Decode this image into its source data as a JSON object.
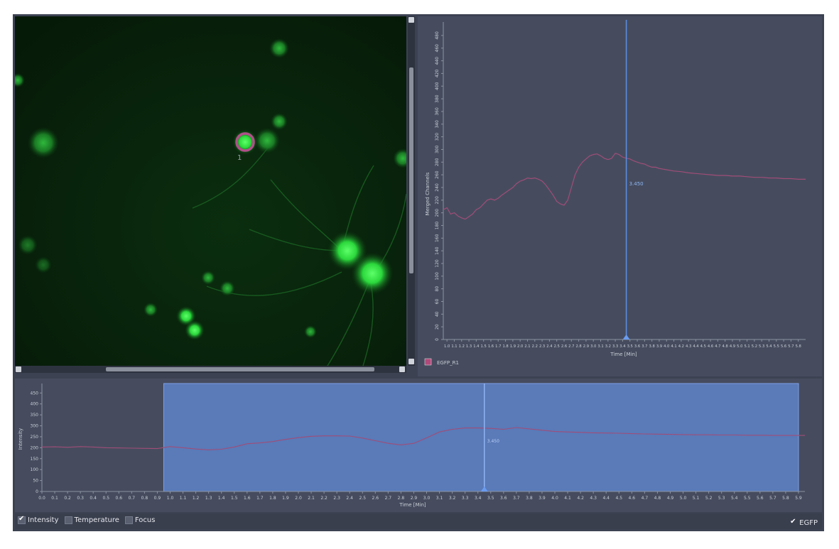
{
  "viewer": {
    "roi_label": "1"
  },
  "upper_chart": {
    "ylabel": "Merged Channels",
    "xlabel": "Time [Min]",
    "cursor_label": "3.450",
    "legend_label": "EGFP_R1"
  },
  "lower_chart": {
    "ylabel": "Intensity",
    "xlabel": "Time [Min]",
    "cursor_label": "3.450"
  },
  "toolbar": {
    "intensity_label": "Intensity",
    "temperature_label": "Temperature",
    "focus_label": "Focus",
    "egfp_label": "EGFP",
    "intensity_checked": true,
    "temperature_checked": false,
    "focus_checked": false,
    "egfp_checked": true
  },
  "colors": {
    "series": "#a04d78",
    "cursor": "#5b8ee6",
    "selection": "#5a7ab8",
    "legend_swatch": "#b04a7a"
  },
  "chart_data": [
    {
      "type": "line",
      "name": "upper",
      "ylabel": "Merged Channels",
      "xlabel": "Time [Min]",
      "ylim": [
        0,
        490
      ],
      "yticks": [
        0,
        20,
        40,
        60,
        80,
        100,
        120,
        140,
        160,
        180,
        200,
        220,
        240,
        260,
        280,
        300,
        320,
        340,
        360,
        380,
        400,
        420,
        440,
        460,
        480
      ],
      "xlim": [
        0.95,
        5.9
      ],
      "xticks": [
        "1.0",
        "1.1",
        "1.2",
        "1.3",
        "1.4",
        "1.5",
        "1.6",
        "1.7",
        "1.8",
        "1.9",
        "2.0",
        "2.1",
        "2.2",
        "2.3",
        "2.4",
        "2.5",
        "2.6",
        "2.7",
        "2.8",
        "2.9",
        "3.0",
        "3.1",
        "3.2",
        "3.3",
        "3.4",
        "3.5",
        "3.6",
        "3.7",
        "3.8",
        "3.9",
        "4.0",
        "4.1",
        "4.2",
        "4.3",
        "4.4",
        "4.5",
        "4.6",
        "4.7",
        "4.8",
        "4.9",
        "5.0",
        "5.1",
        "5.2",
        "5.3",
        "5.4",
        "5.5",
        "5.6",
        "5.7",
        "5.8"
      ],
      "cursor_x": 3.45,
      "legend": [
        "EGFP_R1"
      ],
      "series": [
        {
          "name": "EGFP_R1",
          "x": [
            0.95,
            1.0,
            1.05,
            1.1,
            1.15,
            1.2,
            1.25,
            1.3,
            1.35,
            1.4,
            1.45,
            1.5,
            1.55,
            1.6,
            1.65,
            1.7,
            1.75,
            1.8,
            1.85,
            1.9,
            1.95,
            2.0,
            2.05,
            2.1,
            2.15,
            2.2,
            2.25,
            2.3,
            2.35,
            2.4,
            2.45,
            2.5,
            2.55,
            2.6,
            2.65,
            2.7,
            2.75,
            2.8,
            2.85,
            2.9,
            2.95,
            3.0,
            3.05,
            3.1,
            3.15,
            3.2,
            3.25,
            3.3,
            3.35,
            3.4,
            3.45,
            3.5,
            3.55,
            3.6,
            3.65,
            3.7,
            3.75,
            3.8,
            3.85,
            3.9,
            4.0,
            4.1,
            4.2,
            4.3,
            4.4,
            4.5,
            4.6,
            4.7,
            4.8,
            4.9,
            5.0,
            5.1,
            5.2,
            5.3,
            5.4,
            5.5,
            5.6,
            5.7,
            5.8,
            5.9
          ],
          "values": [
            205,
            208,
            198,
            200,
            195,
            192,
            190,
            194,
            198,
            205,
            208,
            214,
            220,
            222,
            220,
            223,
            228,
            232,
            236,
            240,
            246,
            250,
            252,
            255,
            254,
            255,
            253,
            250,
            244,
            236,
            228,
            218,
            214,
            212,
            220,
            240,
            260,
            272,
            280,
            285,
            290,
            292,
            293,
            290,
            286,
            284,
            286,
            294,
            292,
            288,
            286,
            285,
            282,
            280,
            278,
            277,
            274,
            272,
            272,
            270,
            268,
            266,
            265,
            263,
            262,
            261,
            260,
            259,
            259,
            258,
            258,
            257,
            256,
            256,
            255,
            255,
            254,
            254,
            253,
            253
          ]
        }
      ]
    },
    {
      "type": "line",
      "name": "lower",
      "ylabel": "Intensity",
      "xlabel": "Time [Min]",
      "ylim": [
        0,
        490
      ],
      "yticks": [
        0,
        50,
        100,
        150,
        200,
        250,
        300,
        350,
        400,
        450
      ],
      "xlim": [
        0.0,
        5.95
      ],
      "xticks": [
        "0.0",
        "0.1",
        "0.2",
        "0.3",
        "0.4",
        "0.5",
        "0.6",
        "0.7",
        "0.8",
        "0.9",
        "1.0",
        "1.1",
        "1.2",
        "1.3",
        "1.4",
        "1.5",
        "1.6",
        "1.7",
        "1.8",
        "1.9",
        "2.0",
        "2.1",
        "2.2",
        "2.3",
        "2.4",
        "2.5",
        "2.6",
        "2.7",
        "2.8",
        "2.9",
        "3.0",
        "3.1",
        "3.2",
        "3.3",
        "3.4",
        "3.5",
        "3.6",
        "3.7",
        "3.8",
        "3.9",
        "4.0",
        "4.1",
        "4.2",
        "4.3",
        "4.4",
        "4.5",
        "4.6",
        "4.7",
        "4.8",
        "4.9",
        "5.0",
        "5.1",
        "5.2",
        "5.3",
        "5.4",
        "5.5",
        "5.6",
        "5.7",
        "5.8",
        "5.9"
      ],
      "cursor_x": 3.45,
      "selection": [
        0.95,
        5.9
      ],
      "series": [
        {
          "name": "EGFP_R1",
          "x": [
            0.0,
            0.1,
            0.2,
            0.3,
            0.4,
            0.5,
            0.6,
            0.7,
            0.8,
            0.9,
            1.0,
            1.1,
            1.2,
            1.3,
            1.4,
            1.5,
            1.6,
            1.7,
            1.8,
            1.9,
            2.0,
            2.1,
            2.2,
            2.3,
            2.4,
            2.5,
            2.6,
            2.7,
            2.8,
            2.9,
            3.0,
            3.1,
            3.2,
            3.3,
            3.4,
            3.5,
            3.6,
            3.7,
            3.8,
            3.9,
            4.0,
            4.1,
            4.2,
            4.3,
            4.4,
            4.5,
            4.6,
            4.7,
            4.8,
            4.9,
            5.0,
            5.1,
            5.2,
            5.3,
            5.4,
            5.5,
            5.6,
            5.7,
            5.8,
            5.9,
            5.95
          ],
          "values": [
            203,
            204,
            202,
            205,
            203,
            200,
            199,
            198,
            197,
            196,
            205,
            200,
            194,
            190,
            193,
            203,
            218,
            222,
            228,
            238,
            246,
            252,
            254,
            254,
            253,
            244,
            232,
            220,
            213,
            220,
            245,
            272,
            284,
            290,
            290,
            288,
            284,
            292,
            286,
            280,
            274,
            272,
            270,
            268,
            267,
            266,
            264,
            263,
            262,
            261,
            260,
            259,
            259,
            258,
            258,
            257,
            257,
            256,
            256,
            256,
            256
          ]
        }
      ]
    }
  ]
}
